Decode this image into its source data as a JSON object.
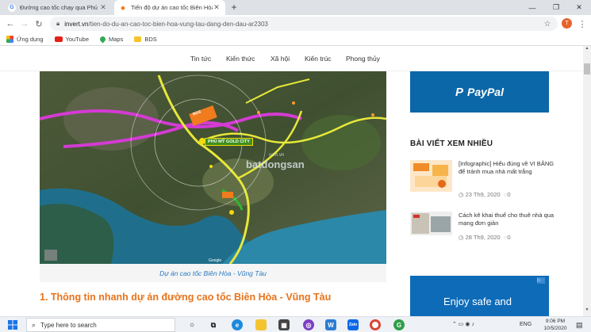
{
  "browser": {
    "tabs": [
      {
        "title": "Đường cao tốc chạy qua Phú Mỹ",
        "favicon": "google-g",
        "favicon_color": "#4285f4"
      },
      {
        "title": "Tiến độ dự án cao tốc Biên Hòa V",
        "favicon": "invert-logo",
        "favicon_color": "#f07c1e"
      }
    ],
    "new_tab": "+",
    "url_domain": "invert.vn",
    "url_path": "/tien-do-du-an-cao-toc-bien-hoa-vung-tau-dang-den-dau-ar2303",
    "profile_initial": "T",
    "bookmarks": [
      {
        "label": "Ứng dụng",
        "icon": "apps-grid-icon"
      },
      {
        "label": "YouTube",
        "icon": "youtube-icon"
      },
      {
        "label": "Maps",
        "icon": "maps-pin-icon"
      },
      {
        "label": "BDS",
        "icon": "folder-icon"
      }
    ]
  },
  "site": {
    "nav": [
      "Tin tức",
      "Kiến thức",
      "Xã hội",
      "Kiến trúc",
      "Phong thủy"
    ]
  },
  "article": {
    "map_labels": {
      "project": "PHÚ MỸ GOLD CITY",
      "watermark_top": "com.vn",
      "watermark": "batdongsan",
      "google": "Google",
      "tag_1": "BDS"
    },
    "caption": "Dự án cao tốc Biên Hòa - Vũng Tàu",
    "heading": "1. Thông tin nhanh dự án đường cao tốc Biên Hòa - Vũng Tàu"
  },
  "sidebar": {
    "paypal": "PayPal",
    "most_viewed_title": "BÀI VIẾT XEM NHIỀU",
    "posts": [
      {
        "title": "[Infographic] Hiểu đúng về VI BẰNG để tránh mua nhà mất trắng",
        "date": "23 Th9, 2020",
        "comments": "0"
      },
      {
        "title": "Cách kê khai thuế cho thuê nhà qua mạng đơn giản",
        "date": "28 Th9, 2020",
        "comments": "0"
      }
    ],
    "ad_text": "Enjoy safe and"
  },
  "taskbar": {
    "search_placeholder": "Type here to search",
    "lang": "ENG",
    "time": "9:06 PM",
    "date": "10/5/2020"
  }
}
